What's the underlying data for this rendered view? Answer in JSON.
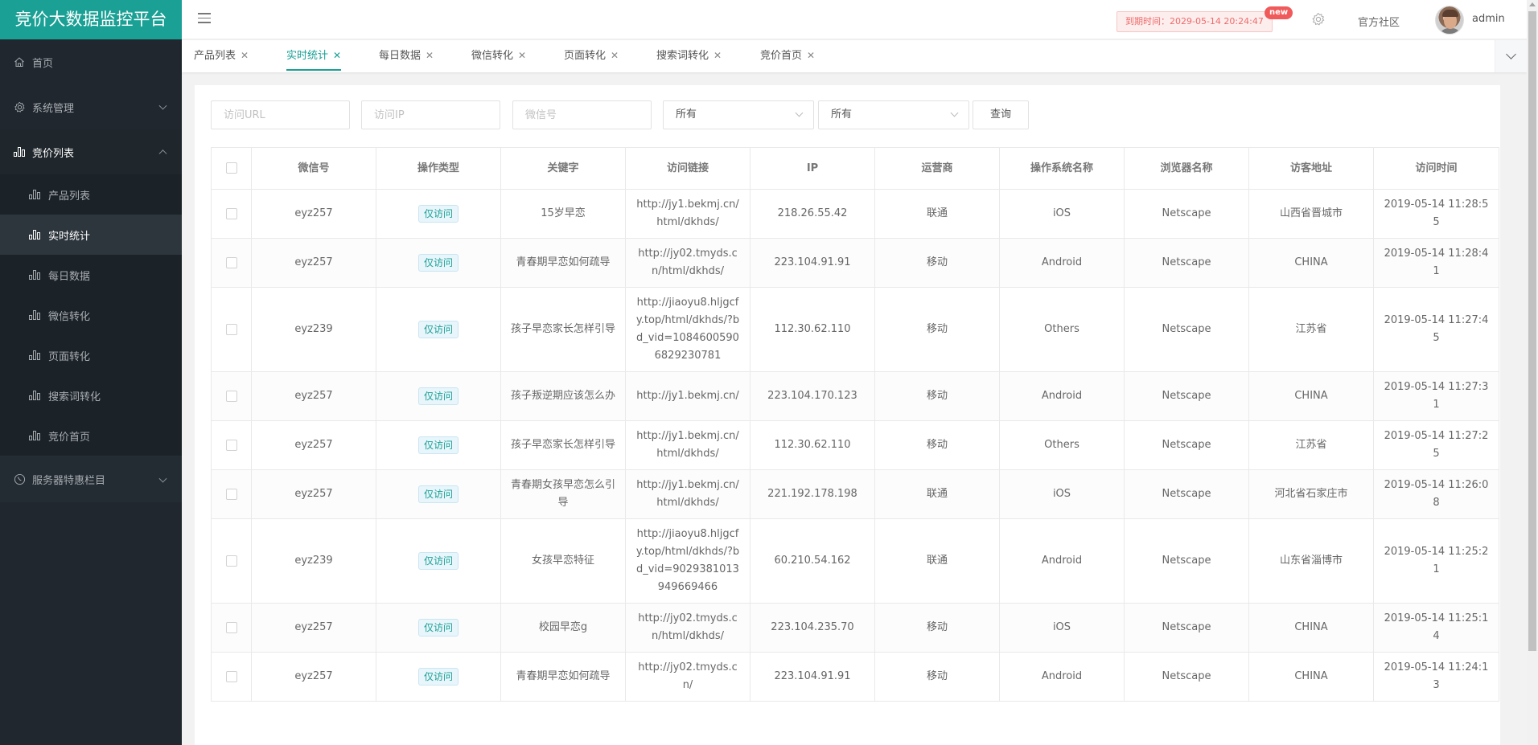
{
  "app": {
    "title": "竞价大数据监控平台"
  },
  "sidebar": {
    "items": [
      {
        "label": "首页",
        "icon": "home-icon"
      },
      {
        "label": "系统管理",
        "icon": "gear-icon"
      },
      {
        "label": "竞价列表",
        "icon": "bar-chart-icon"
      },
      {
        "label": "服务器特惠栏目",
        "icon": "clock-icon"
      }
    ],
    "sub_items": [
      {
        "label": "产品列表"
      },
      {
        "label": "实时统计"
      },
      {
        "label": "每日数据"
      },
      {
        "label": "微信转化"
      },
      {
        "label": "页面转化"
      },
      {
        "label": "搜索词转化"
      },
      {
        "label": "竞价首页"
      }
    ],
    "active_sub": "实时统计"
  },
  "header": {
    "expire_text": "到期时间：2029-05-14 20:24:47",
    "new_badge": "new",
    "community": "官方社区",
    "username": "admin"
  },
  "tabs": [
    {
      "label": "产品列表",
      "active": false
    },
    {
      "label": "实时统计",
      "active": true
    },
    {
      "label": "每日数据",
      "active": false
    },
    {
      "label": "微信转化",
      "active": false
    },
    {
      "label": "页面转化",
      "active": false
    },
    {
      "label": "搜索词转化",
      "active": false
    },
    {
      "label": "竞价首页",
      "active": false
    }
  ],
  "tab_close_glyph": "✕",
  "filters": {
    "url_placeholder": "访问URL",
    "ip_placeholder": "访问IP",
    "wechat_placeholder": "微信号",
    "select1_value": "所有",
    "select2_value": "所有",
    "query_button": "查询"
  },
  "table": {
    "columns": [
      "微信号",
      "操作类型",
      "关键字",
      "访问链接",
      "IP",
      "运营商",
      "操作系统名称",
      "浏览器名称",
      "访客地址",
      "访问时间"
    ],
    "rows": [
      {
        "wechat": "eyz257",
        "type": "仅访问",
        "keyword": "15岁早恋",
        "url": "http://jy1.bekmj.cn/html/dkhds/",
        "ip": "218.26.55.42",
        "isp": "联通",
        "os": "iOS",
        "browser": "Netscape",
        "location": "山西省晋城市",
        "time": "2019-05-14 11:28:55"
      },
      {
        "wechat": "eyz257",
        "type": "仅访问",
        "keyword": "青春期早恋如何疏导",
        "url": "http://jy02.tmyds.cn/html/dkhds/",
        "ip": "223.104.91.91",
        "isp": "移动",
        "os": "Android",
        "browser": "Netscape",
        "location": "CHINA",
        "time": "2019-05-14 11:28:41"
      },
      {
        "wechat": "eyz239",
        "type": "仅访问",
        "keyword": "孩子早恋家长怎样引导",
        "url": "http://jiaoyu8.hljgcfy.top/html/dkhds/?bd_vid=10846005906829230781",
        "ip": "112.30.62.110",
        "isp": "移动",
        "os": "Others",
        "browser": "Netscape",
        "location": "江苏省",
        "time": "2019-05-14 11:27:45"
      },
      {
        "wechat": "eyz257",
        "type": "仅访问",
        "keyword": "孩子叛逆期应该怎么办",
        "url": "http://jy1.bekmj.cn/",
        "ip": "223.104.170.123",
        "isp": "移动",
        "os": "Android",
        "browser": "Netscape",
        "location": "CHINA",
        "time": "2019-05-14 11:27:31"
      },
      {
        "wechat": "eyz257",
        "type": "仅访问",
        "keyword": "孩子早恋家长怎样引导",
        "url": "http://jy1.bekmj.cn/html/dkhds/",
        "ip": "112.30.62.110",
        "isp": "移动",
        "os": "Others",
        "browser": "Netscape",
        "location": "江苏省",
        "time": "2019-05-14 11:27:25"
      },
      {
        "wechat": "eyz257",
        "type": "仅访问",
        "keyword": "青春期女孩早恋怎么引导",
        "url": "http://jy1.bekmj.cn/html/dkhds/",
        "ip": "221.192.178.198",
        "isp": "联通",
        "os": "iOS",
        "browser": "Netscape",
        "location": "河北省石家庄市",
        "time": "2019-05-14 11:26:08"
      },
      {
        "wechat": "eyz239",
        "type": "仅访问",
        "keyword": "女孩早恋特征",
        "url": "http://jiaoyu8.hljgcfy.top/html/dkhds/?bd_vid=9029381013949669466",
        "ip": "60.210.54.162",
        "isp": "联通",
        "os": "Android",
        "browser": "Netscape",
        "location": "山东省淄博市",
        "time": "2019-05-14 11:25:21"
      },
      {
        "wechat": "eyz257",
        "type": "仅访问",
        "keyword": "校园早恋g",
        "url": "http://jy02.tmyds.cn/html/dkhds/",
        "ip": "223.104.235.70",
        "isp": "移动",
        "os": "iOS",
        "browser": "Netscape",
        "location": "CHINA",
        "time": "2019-05-14 11:25:14"
      },
      {
        "wechat": "eyz257",
        "type": "仅访问",
        "keyword": "青春期早恋如何疏导",
        "url": "http://jy02.tmyds.cn/",
        "ip": "223.104.91.91",
        "isp": "移动",
        "os": "Android",
        "browser": "Netscape",
        "location": "CHINA",
        "time": "2019-05-14 11:24:13"
      }
    ]
  },
  "colors": {
    "brand": "#1aa094",
    "sidebar_bg": "#20272e",
    "expire_text": "#f06a6a",
    "new_badge": "#f05a5a"
  }
}
